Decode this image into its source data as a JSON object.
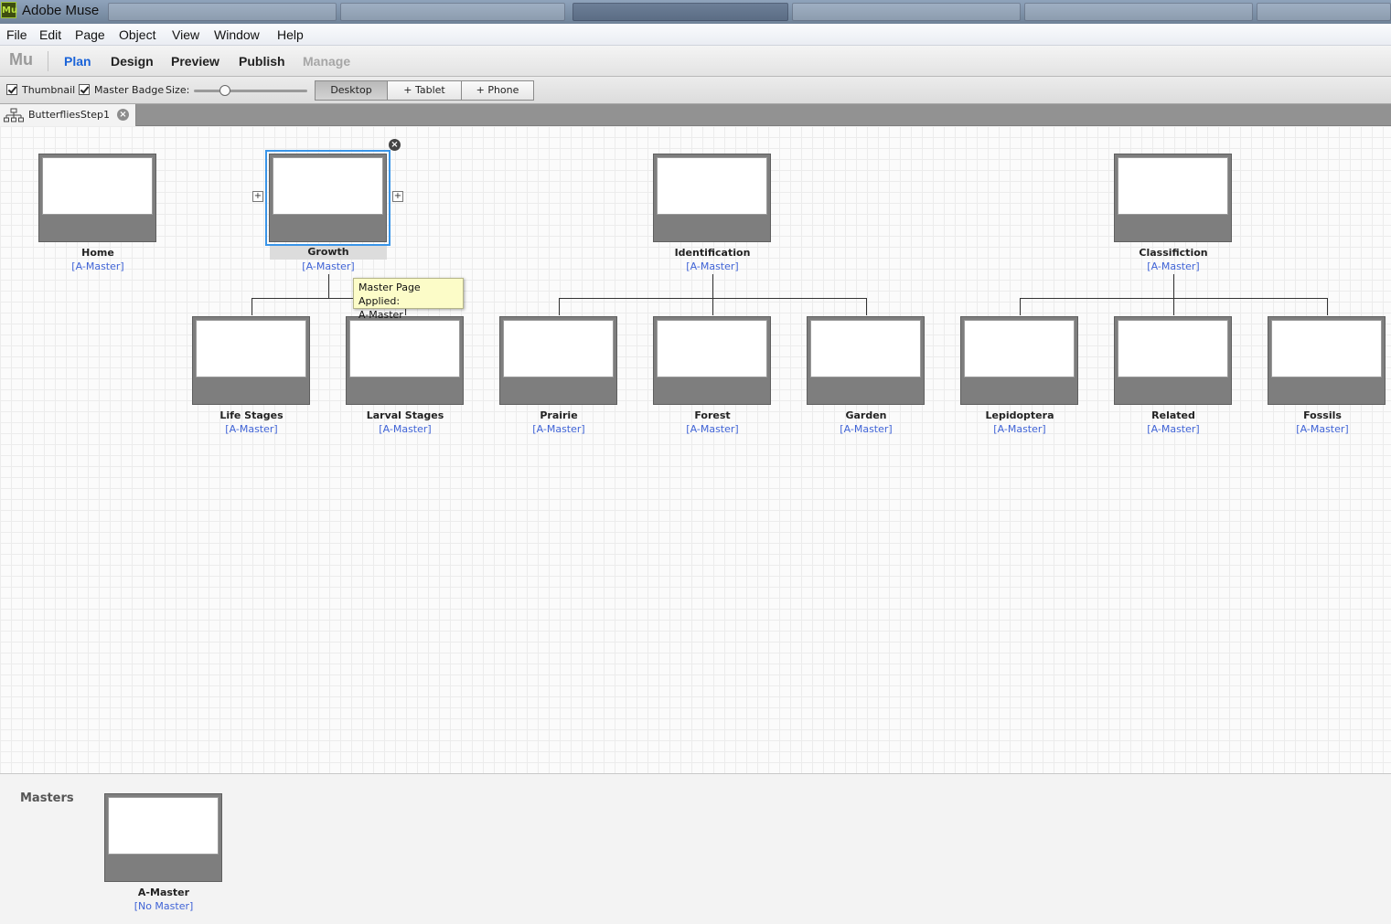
{
  "window": {
    "title": "Adobe Muse",
    "app_icon": "Mu"
  },
  "menu": [
    "File",
    "Edit",
    "Page",
    "Object",
    "View",
    "Window",
    "Help"
  ],
  "modes": {
    "logo": "Mu",
    "items": [
      {
        "label": "Plan",
        "state": "active"
      },
      {
        "label": "Design",
        "state": "normal"
      },
      {
        "label": "Preview",
        "state": "normal"
      },
      {
        "label": "Publish",
        "state": "normal"
      },
      {
        "label": "Manage",
        "state": "disabled"
      }
    ]
  },
  "options": {
    "thumbnail_label": "Thumbnail",
    "thumbnail_checked": true,
    "master_badge_label": "Master Badge",
    "master_badge_checked": true,
    "size_label": "Size:",
    "layouts": [
      {
        "label": "Desktop",
        "active": true
      },
      {
        "label": "Tablet",
        "prefix": "+"
      },
      {
        "label": "Phone",
        "prefix": "+"
      }
    ]
  },
  "tab": {
    "label": "ButterfliesStep1",
    "close_icon": "close-icon"
  },
  "sitemap": {
    "top_pages": [
      {
        "name": "Home",
        "master": "[A-Master]"
      },
      {
        "name": "Growth",
        "master": "[A-Master]",
        "selected": true
      },
      {
        "name": "Identification",
        "master": "[A-Master]"
      },
      {
        "name": "Classifiction",
        "master": "[A-Master]"
      }
    ],
    "child_pages": [
      {
        "name": "Life Stages",
        "master": "[A-Master]",
        "parent": "Growth"
      },
      {
        "name": "Larval Stages",
        "master": "[A-Master]",
        "parent": "Growth"
      },
      {
        "name": "Prairie",
        "master": "[A-Master]",
        "parent": "Identification"
      },
      {
        "name": "Forest",
        "master": "[A-Master]",
        "parent": "Identification"
      },
      {
        "name": "Garden",
        "master": "[A-Master]",
        "parent": "Identification"
      },
      {
        "name": "Lepidoptera",
        "master": "[A-Master]",
        "parent": "Classifiction"
      },
      {
        "name": "Related",
        "master": "[A-Master]",
        "parent": "Classifiction"
      },
      {
        "name": "Fossils",
        "master": "[A-Master]",
        "parent": "Classifiction"
      }
    ]
  },
  "tooltip": {
    "line1": "Master Page Applied:",
    "line2": "A-Master"
  },
  "masters": {
    "title": "Masters",
    "items": [
      {
        "name": "A-Master",
        "master": "[No Master]"
      }
    ]
  },
  "colors": {
    "selection": "#3a95e8",
    "plan_active": "#1a63d8",
    "master_link": "#3f63d6",
    "tooltip_bg": "#fcfcc8"
  }
}
